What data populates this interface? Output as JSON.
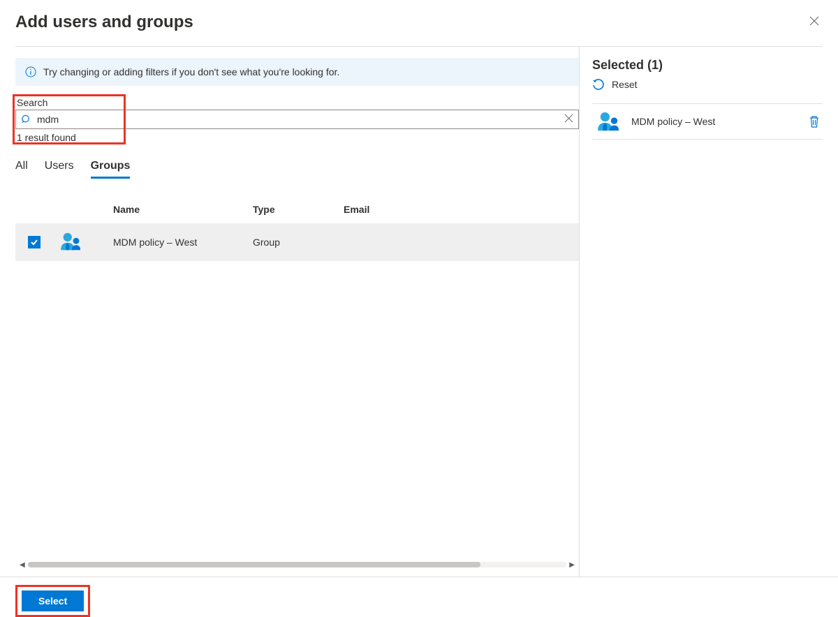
{
  "header": {
    "title": "Add users and groups"
  },
  "info": {
    "text": "Try changing or adding filters if you don't see what you're looking for."
  },
  "search": {
    "label": "Search",
    "value": "mdm",
    "resultText": "1 result found"
  },
  "tabs": {
    "all": "All",
    "users": "Users",
    "groups": "Groups"
  },
  "columns": {
    "name": "Name",
    "type": "Type",
    "email": "Email"
  },
  "results": [
    {
      "name": "MDM policy – West",
      "type": "Group",
      "email": ""
    }
  ],
  "selected": {
    "title": "Selected (1)",
    "reset": "Reset",
    "items": [
      {
        "name": "MDM policy – West"
      }
    ]
  },
  "footer": {
    "select": "Select"
  }
}
